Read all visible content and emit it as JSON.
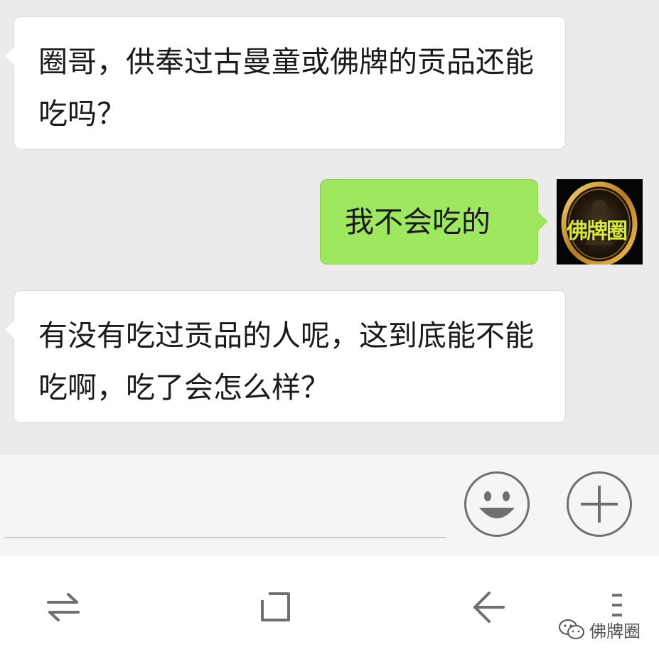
{
  "messages": [
    {
      "side": "left",
      "text": "圈哥，供奉过古曼童或佛牌的贡品还能吃吗？"
    },
    {
      "side": "right",
      "text": "我不会吃的"
    },
    {
      "side": "left",
      "text": "有没有吃过贡品的人呢，这到底能不能吃啊，吃了会怎么样？"
    }
  ],
  "avatar": {
    "label": "佛牌圈",
    "icon": "buddha-amulet-avatar"
  },
  "input_bar": {
    "emoji_icon": "smiley-face-icon",
    "more_icon": "plus-icon",
    "value": ""
  },
  "navbar": {
    "icons": [
      "switch-arrows-icon",
      "square-home-icon",
      "back-arrow-icon",
      "menu-dots-icon"
    ]
  },
  "watermark": {
    "text": "佛牌圈",
    "icon": "wechat-icon"
  },
  "colors": {
    "chat_bg": "#ebebeb",
    "incoming_bubble": "#ffffff",
    "outgoing_bubble": "#9fe75f",
    "input_bar_bg": "#f5f5f5",
    "icon_gray": "#6f6f6f"
  }
}
